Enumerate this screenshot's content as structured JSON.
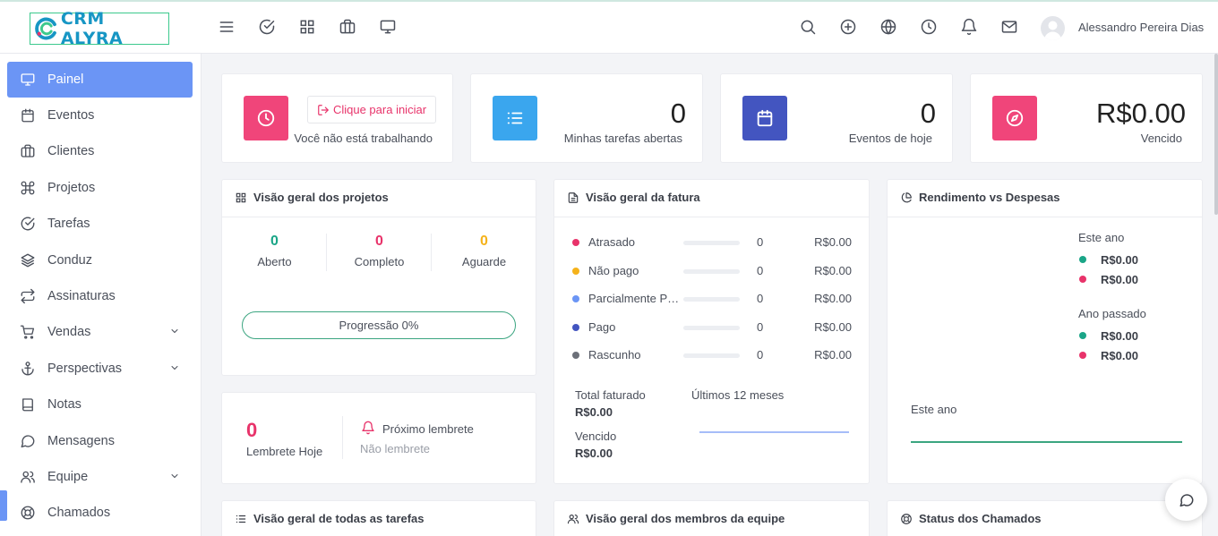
{
  "brand": {
    "name": "CRM ALYRA"
  },
  "user": {
    "name": "Alessandro Pereira Dias"
  },
  "sidebar": {
    "items": [
      {
        "label": "Painel",
        "icon": "monitor-icon",
        "active": true
      },
      {
        "label": "Eventos",
        "icon": "calendar-icon"
      },
      {
        "label": "Clientes",
        "icon": "briefcase-icon"
      },
      {
        "label": "Projetos",
        "icon": "command-icon"
      },
      {
        "label": "Tarefas",
        "icon": "check-circle-icon"
      },
      {
        "label": "Conduz",
        "icon": "layers-icon"
      },
      {
        "label": "Assinaturas",
        "icon": "repeat-icon"
      },
      {
        "label": "Vendas",
        "icon": "cart-icon",
        "expandable": true
      },
      {
        "label": "Perspectivas",
        "icon": "anchor-icon",
        "expandable": true
      },
      {
        "label": "Notas",
        "icon": "book-icon"
      },
      {
        "label": "Mensagens",
        "icon": "message-icon"
      },
      {
        "label": "Equipe",
        "icon": "users-icon",
        "expandable": true
      },
      {
        "label": "Chamados",
        "icon": "lifebuoy-icon"
      }
    ]
  },
  "stats": {
    "clock": {
      "button_label": "Clique para iniciar",
      "status": "Você não está trabalhando",
      "color": "#f0457a"
    },
    "tasks": {
      "value": "0",
      "label": "Minhas tarefas abertas",
      "color": "#3aa6ee"
    },
    "events": {
      "value": "0",
      "label": "Eventos de hoje",
      "color": "#4355c0"
    },
    "overdue": {
      "value": "R$0.00",
      "label": "Vencido",
      "color": "#f0457a"
    }
  },
  "projects": {
    "title": "Visão geral dos projetos",
    "columns": [
      {
        "value": "0",
        "label": "Aberto",
        "color": "#1aa587"
      },
      {
        "value": "0",
        "label": "Completo",
        "color": "#e8336a"
      },
      {
        "value": "0",
        "label": "Aguarde",
        "color": "#f5b21a"
      }
    ],
    "progress_label": "Progressão 0%"
  },
  "reminders": {
    "count": "0",
    "today_label": "Lembrete Hoje",
    "next_label": "Próximo lembrete",
    "none_label": "Não lembrete"
  },
  "invoices": {
    "title": "Visão geral da fatura",
    "rows": [
      {
        "name": "Atrasado",
        "count": "0",
        "amount": "R$0.00",
        "color": "#e8336a"
      },
      {
        "name": "Não pago",
        "count": "0",
        "amount": "R$0.00",
        "color": "#f5b21a"
      },
      {
        "name": "Parcialmente Pago",
        "count": "0",
        "amount": "R$0.00",
        "color": "#6b95f5"
      },
      {
        "name": "Pago",
        "count": "0",
        "amount": "R$0.00",
        "color": "#4355c0"
      },
      {
        "name": "Rascunho",
        "count": "0",
        "amount": "R$0.00",
        "color": "#6c7079"
      }
    ],
    "total_label": "Total faturado",
    "total_value": "R$0.00",
    "overdue_label": "Vencido",
    "overdue_value": "R$0.00",
    "period_label": "Últimos 12 meses"
  },
  "income": {
    "title": "Rendimento vs Despesas",
    "this_year_label": "Este ano",
    "this_year_income": "R$0.00",
    "this_year_expense": "R$0.00",
    "last_year_label": "Ano passado",
    "last_year_income": "R$0.00",
    "last_year_expense": "R$0.00",
    "chart_label": "Este ano",
    "income_color": "#1aa587",
    "expense_color": "#e8336a"
  },
  "bottom_cards": {
    "tasks_title": "Visão geral de todas as tarefas",
    "team_title": "Visão geral dos membros da equipe",
    "tickets_title": "Status dos Chamados"
  }
}
